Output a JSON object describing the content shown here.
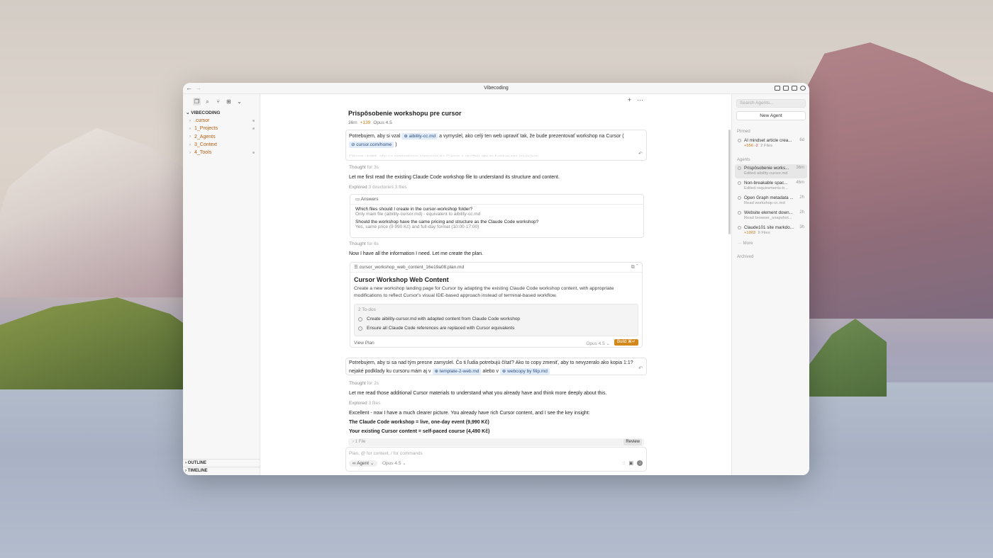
{
  "window": {
    "title": "Vibecoding"
  },
  "sidebar": {
    "root": "VIBECODING",
    "items": [
      {
        "label": ".cursor",
        "dot": true
      },
      {
        "label": "1_Projects",
        "dot": true
      },
      {
        "label": "2_Agents",
        "dot": false
      },
      {
        "label": "3_Context",
        "dot": false
      },
      {
        "label": "4_Tools",
        "dot": true
      }
    ],
    "outline": "OUTLINE",
    "timeline": "TIMELINE"
  },
  "chat": {
    "title": "Prispôsobenie workshopu pre cursor",
    "meta_time": "36m",
    "meta_add": "+139",
    "meta_model": "Opus 4.5",
    "msg1": {
      "part1": "Potrebujem, aby si vzal",
      "chip1": "aibility-cc.md",
      "part2": "a vymyslel, ako celý ten web upraviť tak, že bude prezentovať workshop na Cursor (",
      "chip2": "cursor.com/home",
      "part3": ")",
      "fade": "Chcem urobiť, aby sa prezentácia zamerala na Cursor a ukážku ako to funguje pre vývojárov ..."
    },
    "thought1": {
      "label": "Thought",
      "dur": "for 3s"
    },
    "reply1": "Let me first read the existing Claude Code workshop file to understand its structure and content.",
    "explored1": {
      "label": "Explored",
      "detail": "3 directories 3 files"
    },
    "answers": {
      "header": "Answers",
      "q1": "Which files should I create in the cursor-workshop folder?",
      "a1": "Only main file (aibility-cursor.md) - equivalent to aibility-cc.md",
      "q2": "Should the workshop have the same pricing and structure as the Claude Code workshop?",
      "a2": "Yes, same price (9 990 Kč) and full-day format (10:00-17:00)"
    },
    "thought2": {
      "label": "Thought",
      "dur": "for 6s"
    },
    "reply2": "Now I have all the information I need. Let me create the plan.",
    "plan": {
      "file": "cursor_workshop_web_content_16e19a08.plan.md",
      "title": "Cursor Workshop Web Content",
      "desc": "Create a new workshop landing page for Cursor by adapting the existing Claude Code workshop content, with appropriate modifications to reflect Cursor's visual IDE-based approach instead of terminal-based workflow.",
      "todos_label": "2 To-dos",
      "todos": [
        "Create aibility-cursor.md with adapted content from Claude Code workshop",
        "Ensure all Claude Code references are replaced with Cursor equivalents"
      ],
      "view": "View Plan",
      "model": "Opus 4.5",
      "build": "Build ⌘↵"
    },
    "msg2": {
      "part1": "Potrebujem, aby si sa nad tým presne zamyslel. Čo ti ľudia potrebujú čítať? Ako to copy zmeniť, aby to nevyzeralo ako kopia 1:1?",
      "part2": "nejaké podklady ku cursoru mám aj v",
      "chip1": "template-2-web.md",
      "part3": "alebo v",
      "chip2": "webcopy by filip.md"
    },
    "thought3": {
      "label": "Thought",
      "dur": "for 2s"
    },
    "reply3": "Let me read those additional Cursor materials to understand what you already have and think more deeply about this.",
    "explored2": {
      "label": "Explored",
      "detail": "3 files"
    },
    "reply4": "Excellent - now I have a much clearer picture. You already have rich Cursor content, and I see the key insight:",
    "bold1": "The Claude Code workshop = live, one-day event (9,990 Kč)",
    "bold2": "Your existing Cursor content = self-paced course (4,490 Kč)",
    "files": {
      "label": "1 File",
      "review": "Review"
    },
    "composer": {
      "placeholder": "Plan, @ for context, / for commands",
      "mode": "Agent",
      "model": "Opus 4.5"
    }
  },
  "right": {
    "search_placeholder": "Search Agents...",
    "new_agent": "New Agent",
    "pinned_label": "Pinned",
    "pinned": [
      {
        "name": "AI mindset article crea...",
        "time": "6d",
        "add": "+556",
        "del": "-2",
        "sub": "2 Files"
      }
    ],
    "agents_label": "Agents",
    "agents": [
      {
        "name": "Prispôsobenie works...",
        "time": "36m",
        "sub": "Edited aibility-cursor.md",
        "selected": true
      },
      {
        "name": "Non-breakable spac...",
        "time": "46m",
        "sub": "Edited requirements-tr..."
      },
      {
        "name": "Open Graph metadata ...",
        "time": "2h",
        "sub": "Read workshop-cc.md"
      },
      {
        "name": "Website element down...",
        "time": "2h",
        "sub": "Read browser_snapshot..."
      },
      {
        "name": "Claude101 site markdo...",
        "time": "3h",
        "add": "+1003",
        "sub": "9 Files"
      }
    ],
    "more": "More",
    "archived_label": "Archived"
  }
}
